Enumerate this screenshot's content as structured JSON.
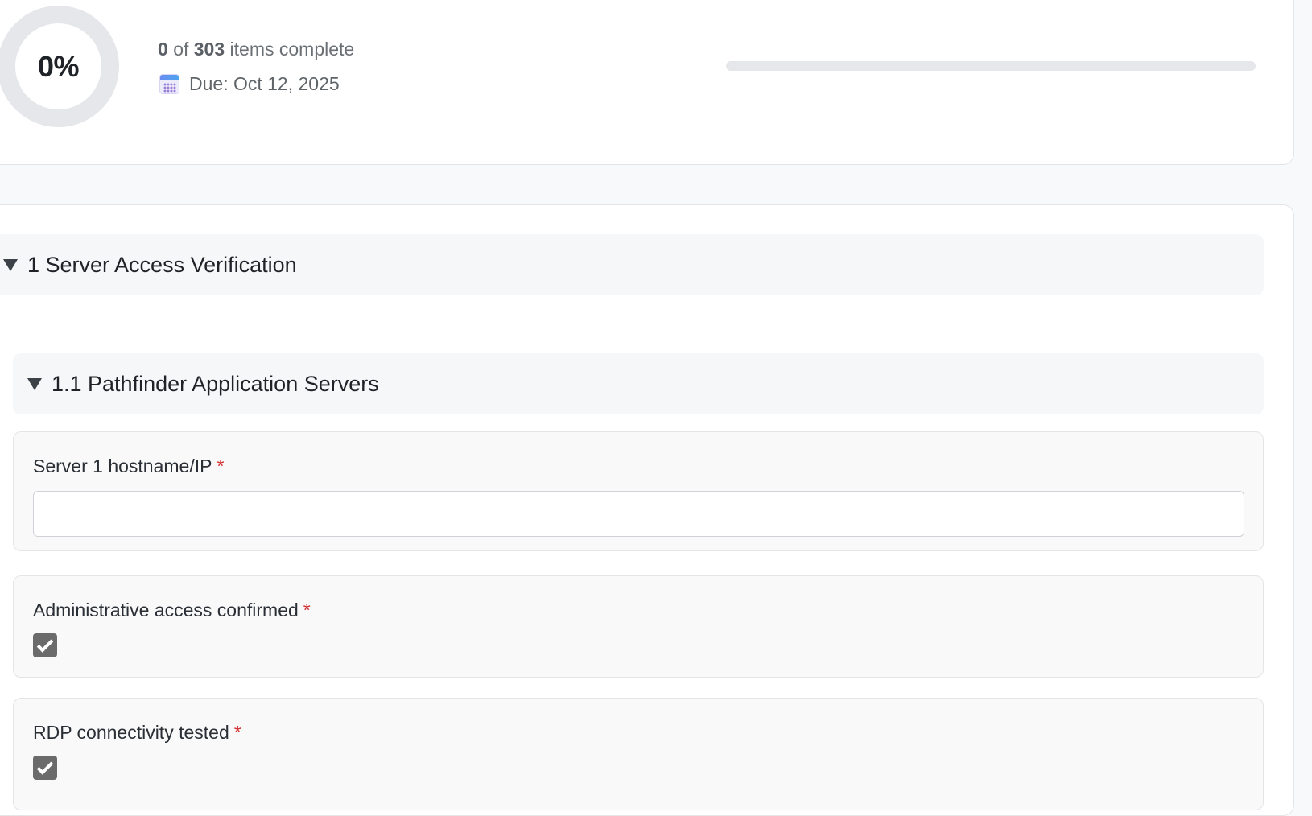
{
  "summary": {
    "percent_label": "0%",
    "percent_value": 0,
    "completed": "0",
    "of_word": "of",
    "total": "303",
    "items_suffix": "items complete",
    "due_label": "Due: Oct 12, 2025",
    "due_icon": "calendar-icon",
    "progress_fraction": 0
  },
  "sections": [
    {
      "title": "1 Server Access Verification",
      "expanded": true,
      "subsections": [
        {
          "title": "1.1 Pathfinder Application Servers",
          "expanded": true,
          "fields": [
            {
              "type": "text",
              "label": "Server 1 hostname/IP",
              "required_marker": "*",
              "value": "",
              "placeholder": ""
            },
            {
              "type": "checkbox",
              "label": "Administrative access confirmed",
              "required_marker": "*",
              "checked": true
            },
            {
              "type": "checkbox",
              "label": "RDP connectivity tested",
              "required_marker": "*",
              "checked": true
            }
          ]
        }
      ]
    }
  ],
  "colors": {
    "required": "#d32f2f",
    "ring_track": "#e6e7ea",
    "checkbox_fill": "#6b6b6b"
  }
}
